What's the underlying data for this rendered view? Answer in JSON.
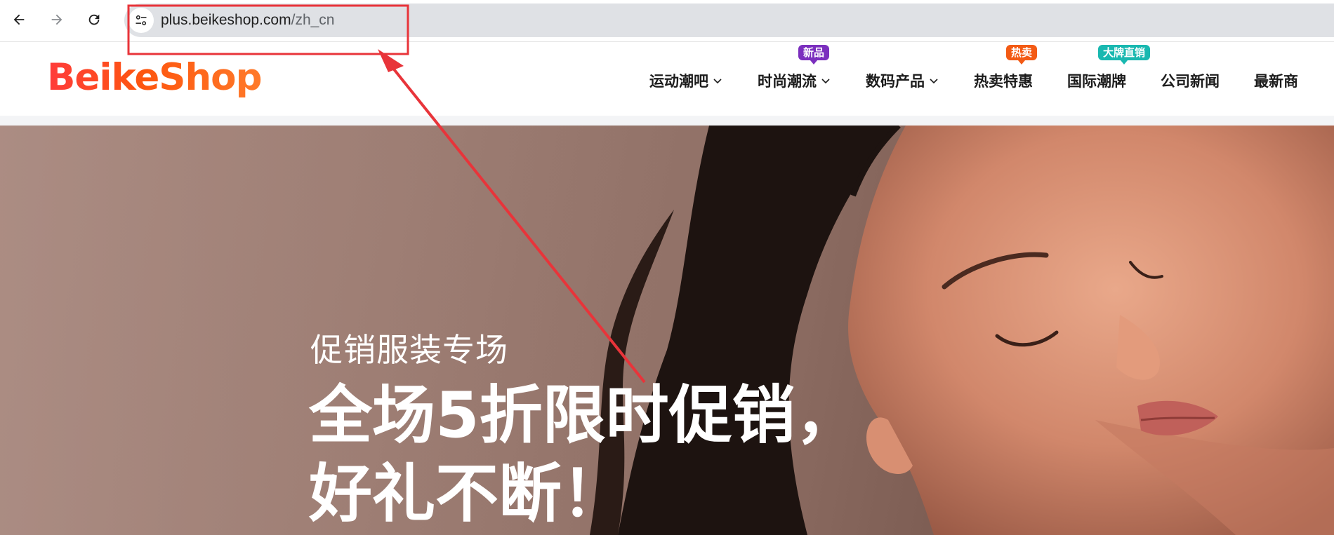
{
  "browser": {
    "back_icon": "arrow-left-icon",
    "forward_icon": "arrow-right-icon",
    "reload_icon": "reload-icon",
    "site_info_icon": "tune-icon",
    "url_host": "plus.beikeshop.com",
    "url_path": "/zh_cn"
  },
  "site": {
    "logo": "BeikeShop",
    "menu": [
      {
        "label": "运动潮吧",
        "has_dropdown": true,
        "tag": null
      },
      {
        "label": "时尚潮流",
        "has_dropdown": true,
        "tag": "新品",
        "tag_color": "#7b2fbe"
      },
      {
        "label": "数码产品",
        "has_dropdown": true,
        "tag": null
      },
      {
        "label": "热卖特惠",
        "has_dropdown": false,
        "tag": "热卖",
        "tag_color": "#f35a14"
      },
      {
        "label": "国际潮牌",
        "has_dropdown": false,
        "tag": "大牌直销",
        "tag_color": "#19b8b0"
      },
      {
        "label": "公司新闻",
        "has_dropdown": false,
        "tag": null
      },
      {
        "label": "最新商",
        "has_dropdown": false,
        "tag": null
      }
    ]
  },
  "hero": {
    "subtitle": "促销服装专场",
    "title_line1": "全场5折限时促销，",
    "title_line2": "好礼不断！"
  },
  "colors": {
    "brand": "#fd560f",
    "annotation": "#e8343a",
    "omnibox": "#dfe1e5"
  }
}
